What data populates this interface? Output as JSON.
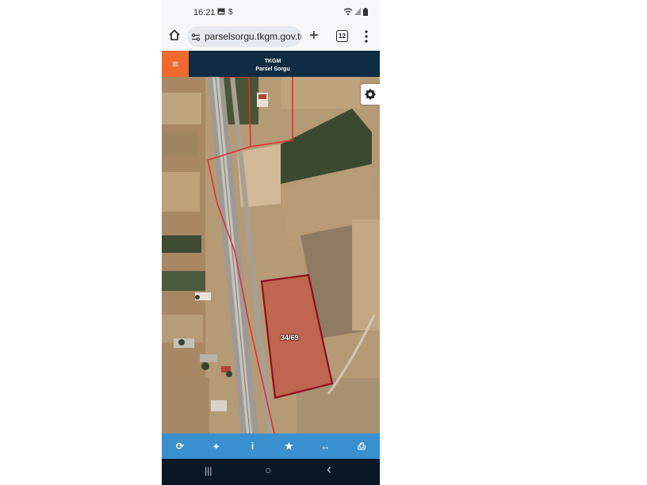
{
  "status_bar": {
    "time": "16:21",
    "icons": [
      "gallery-icon",
      "dollar-icon",
      "wifi-icon",
      "signal-icon",
      "battery-icon"
    ]
  },
  "browser": {
    "url": "parselsorgu.tkgm.gov.tr",
    "tab_count": "12"
  },
  "app": {
    "title": "TKGM",
    "subtitle": "Parsel Sorgu",
    "menu_icon": "≡",
    "accent_color": "#f06a30",
    "header_color": "#0e2c42"
  },
  "map": {
    "parcel_label": "34/69",
    "boundary_color": "#e03030",
    "parcel_outline_color": "#8b0f1c",
    "settings_icon": "gear-icon"
  },
  "toolbar": {
    "color": "#3a8fcf",
    "buttons": [
      {
        "name": "refresh",
        "glyph": "⟳"
      },
      {
        "name": "locate",
        "glyph": "⌖"
      },
      {
        "name": "info",
        "glyph": "i"
      },
      {
        "name": "favorite",
        "glyph": "★"
      },
      {
        "name": "measure",
        "glyph": "↔"
      },
      {
        "name": "print",
        "glyph": "⎙"
      }
    ]
  },
  "nav_bar": {
    "recents": "|||",
    "home": "○",
    "back": "‹"
  }
}
